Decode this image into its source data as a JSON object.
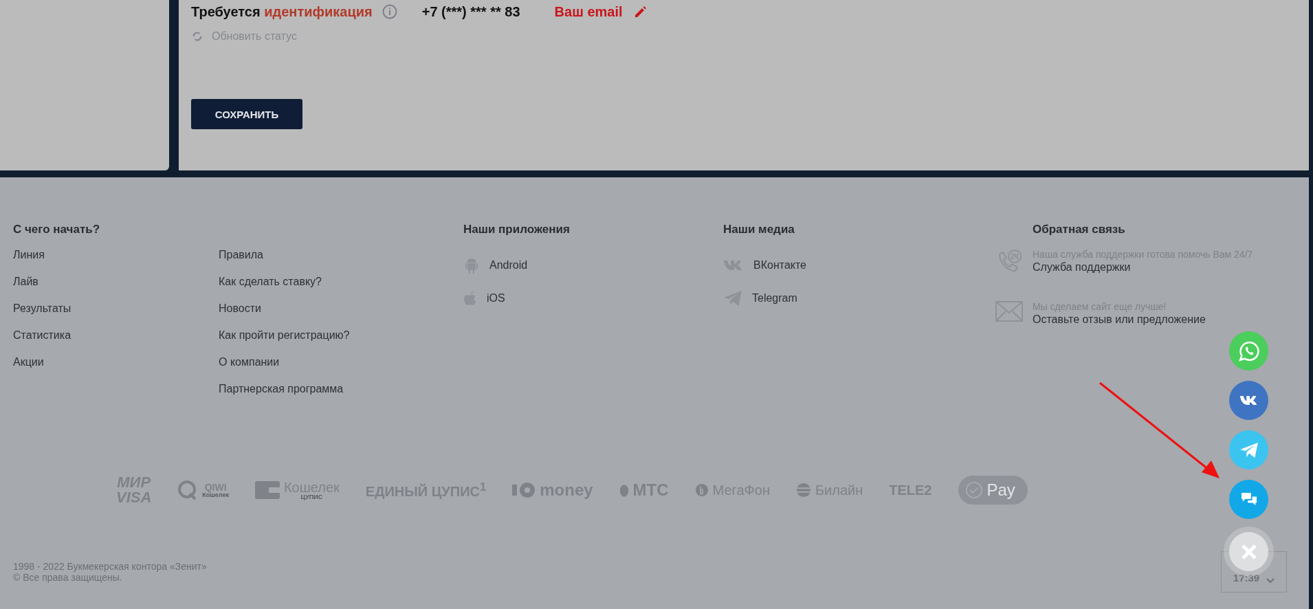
{
  "profile": {
    "status_prefix": "Требуется",
    "status_link": "идентификация",
    "phone": "+7 (***) *** ** 83",
    "email_label": "Ваш email",
    "refresh": "Обновить статус",
    "save_button": "СОХРАНИТЬ"
  },
  "footer": {
    "columns": [
      {
        "kind": "links",
        "title": "С чего начать?",
        "items": [
          "Линия",
          "Лайв",
          "Результаты",
          "Статистика",
          "Акции"
        ]
      },
      {
        "kind": "links",
        "items": [
          "Правила",
          "Как сделать ставку?",
          "Новости",
          "Как пройти регистрацию?",
          "О компании",
          "Партнерская программа"
        ]
      },
      {
        "kind": "apps",
        "title": "Наши приложения",
        "items": [
          {
            "kind": "android",
            "label": "Android"
          },
          {
            "kind": "apple",
            "label": "iOS"
          }
        ]
      },
      {
        "kind": "apps",
        "title": "Наши медиа",
        "items": [
          {
            "kind": "vk",
            "label": "ВКонтакте"
          },
          {
            "kind": "telegram",
            "label": "Telegram"
          }
        ]
      },
      {
        "kind": "feedback",
        "title": "Обратная связь",
        "items": [
          {
            "kind": "phone24",
            "hint": "Наша служба поддержки готова помочь Вам 24/7",
            "link": "Служба поддержки"
          },
          {
            "kind": "mail",
            "hint": "Мы сделаем сайт еще лучше!",
            "link": "Оставьте отзыв или предложение"
          }
        ]
      }
    ],
    "payments": [
      {
        "kind": "stack",
        "lines": [
          "МИР",
          "VISA"
        ]
      },
      {
        "kind": "qiwi",
        "lines": [
          "QIWI",
          "Кошелек"
        ]
      },
      {
        "kind": "wallet",
        "lines": [
          "Кошелек",
          "ЦУПИС"
        ]
      },
      {
        "kind": "plain",
        "lines": [
          "ЕДИНЫЙ ЦУПИС$^{1}$"
        ]
      },
      {
        "kind": "yoomoney",
        "lines": [
          "money"
        ]
      },
      {
        "kind": "egg",
        "lines": [
          "МТС"
        ]
      },
      {
        "kind": "megafon",
        "lines": [
          "МегаФон"
        ]
      },
      {
        "kind": "beeline",
        "lines": [
          "Билайн"
        ]
      },
      {
        "kind": "plain",
        "lines": [
          "TELE2"
        ]
      },
      {
        "kind": "pay",
        "lines": [
          "Pay"
        ]
      }
    ],
    "copyright": [
      "1998 - 2022 Букмекерская контора «Зенит»",
      "© Все права защищены."
    ],
    "time": "17:39"
  },
  "chat_buttons": [
    {
      "kind": "whatsapp",
      "color": "#4bce5b"
    },
    {
      "kind": "vk",
      "color": "#3f74c2"
    },
    {
      "kind": "telegram",
      "color": "#3cc4f0"
    },
    {
      "kind": "chat",
      "color": "#12a8e8"
    },
    {
      "kind": "close",
      "color": "#dedfe0"
    }
  ]
}
